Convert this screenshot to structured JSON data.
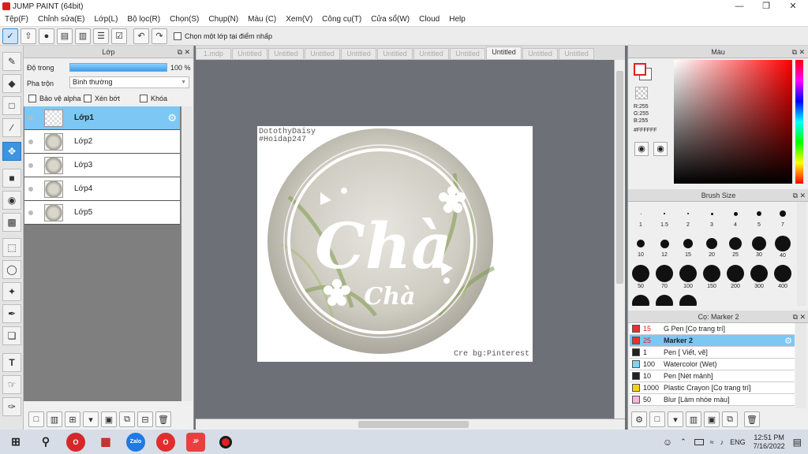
{
  "app": {
    "title": "JUMP PAINT (64bit)"
  },
  "menu": [
    "Tệp(F)",
    "Chỉnh sửa(E)",
    "Lớp(L)",
    "Bộ lọc(R)",
    "Chọn(S)",
    "Chụp(N)",
    "Màu (C)",
    "Xem(V)",
    "Công cụ(T)",
    "Cửa sổ(W)",
    "Cloud",
    "Help"
  ],
  "toolbar": {
    "select_layer_label": "Chọn một lớp tại điểm nhấp"
  },
  "layer_panel": {
    "title": "Lớp",
    "opacity_label": "Độ trong",
    "opacity_value": "100 %",
    "opacity_level": 1.0,
    "blend_label": "Pha trộn",
    "blend_value": "Bình thường",
    "protect_alpha": "Bảo vệ alpha",
    "clipping": "Xén bớt",
    "lock": "Khóa",
    "layers": [
      "Lớp1",
      "Lớp2",
      "Lớp3",
      "Lớp4",
      "Lớp5"
    ]
  },
  "tabs": [
    "1.mdp",
    "Untitled",
    "Untitled",
    "Untitled",
    "Untitled",
    "Untitled",
    "Untitled",
    "Untitled",
    "Untitled",
    "Untitled",
    "Untitled"
  ],
  "canvas": {
    "credit_top_1": "DotothyDaisy",
    "credit_top_2": "#Hoidap247",
    "main_text": "Chà",
    "sub_text": "Chà",
    "credit_bottom": "Cre bg:Pinterest"
  },
  "color_panel": {
    "title": "Màu",
    "r": "R:255",
    "g": "G:255",
    "b": "B:255",
    "hex": "#FFFFFF"
  },
  "brush_size_panel": {
    "title": "Brush Size",
    "sizes": [
      "1",
      "1.5",
      "2",
      "3",
      "4",
      "5",
      "7",
      "10",
      "12",
      "15",
      "20",
      "25",
      "30",
      "40",
      "50",
      "70",
      "100",
      "150",
      "200",
      "300",
      "400"
    ]
  },
  "brush_panel": {
    "title": "Cọ: Marker 2",
    "brushes": [
      {
        "size": "15",
        "name": "G Pen [Cọ trang trí]",
        "color": "#e83030"
      },
      {
        "size": "25",
        "name": "Marker 2",
        "color": "#e83030"
      },
      {
        "size": "1",
        "name": "Pen [ Viết, vẽ]",
        "color": "#222222"
      },
      {
        "size": "100",
        "name": "Watercolor (Wet)",
        "color": "#7fd4ef"
      },
      {
        "size": "10",
        "name": "Pen [Nét mảnh]",
        "color": "#222222"
      },
      {
        "size": "1000",
        "name": "Plastic Crayon [Cọ trang trí]",
        "color": "#f4d21a"
      },
      {
        "size": "50",
        "name": "Blur [Làm nhòe màu]",
        "color": "#f8b6dc"
      }
    ]
  },
  "taskbar": {
    "lang": "ENG",
    "time": "12:51 PM",
    "date": "7/16/2022",
    "zalo": "Zalo"
  }
}
